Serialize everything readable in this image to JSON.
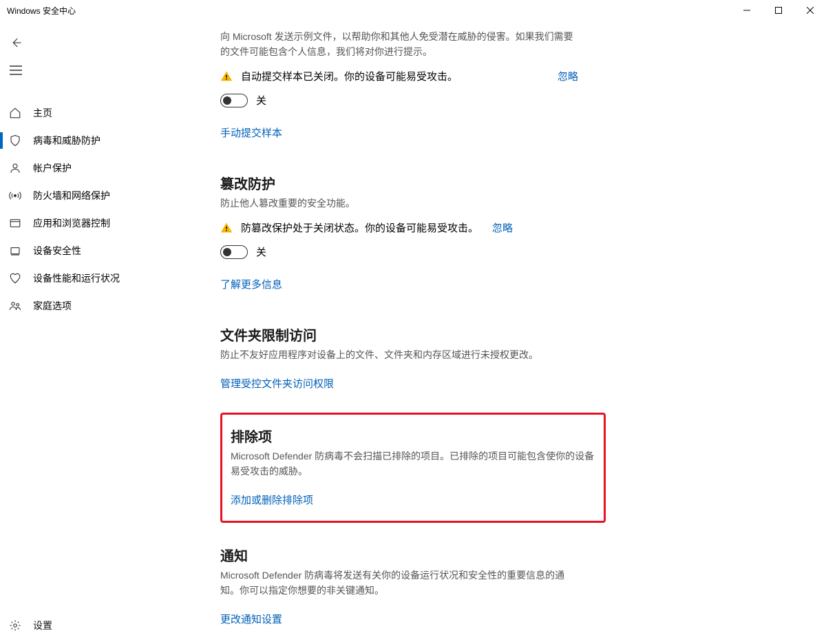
{
  "window": {
    "title": "Windows 安全中心"
  },
  "sidebar": {
    "items": [
      {
        "label": "主页"
      },
      {
        "label": "病毒和威胁防护"
      },
      {
        "label": "帐户保护"
      },
      {
        "label": "防火墙和网络保护"
      },
      {
        "label": "应用和浏览器控制"
      },
      {
        "label": "设备安全性"
      },
      {
        "label": "设备性能和运行状况"
      },
      {
        "label": "家庭选项"
      }
    ],
    "settings_label": "设置"
  },
  "sections": {
    "sample": {
      "desc": "向 Microsoft 发送示例文件，以帮助你和其他人免受潜在威胁的侵害。如果我们需要的文件可能包含个人信息，我们将对你进行提示。",
      "warn": "自动提交样本已关闭。你的设备可能易受攻击。",
      "dismiss": "忽略",
      "toggle_state": "关",
      "link": "手动提交样本"
    },
    "tamper": {
      "title": "篡改防护",
      "desc": "防止他人篡改重要的安全功能。",
      "warn": "防篡改保护处于关闭状态。你的设备可能易受攻击。",
      "dismiss": "忽略",
      "toggle_state": "关",
      "link": "了解更多信息"
    },
    "folder": {
      "title": "文件夹限制访问",
      "desc": "防止不友好应用程序对设备上的文件、文件夹和内存区域进行未授权更改。",
      "link": "管理受控文件夹访问权限"
    },
    "exclusions": {
      "title": "排除项",
      "desc": "Microsoft Defender 防病毒不会扫描已排除的项目。已排除的项目可能包含使你的设备易受攻击的威胁。",
      "link": "添加或删除排除项"
    },
    "notify": {
      "title": "通知",
      "desc": "Microsoft Defender 防病毒将发送有关你的设备运行状况和安全性的重要信息的通知。你可以指定你想要的非关键通知。",
      "link": "更改通知设置"
    }
  }
}
